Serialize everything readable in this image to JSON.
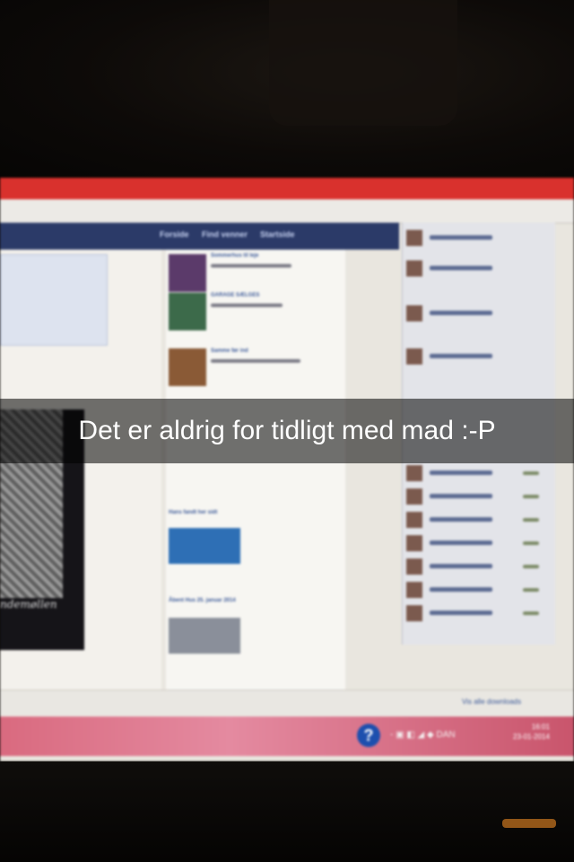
{
  "snap": {
    "caption": "Det er aldrig for tidligt med mad :-P"
  },
  "facebook": {
    "nav": [
      "Forside",
      "Find venner",
      "Startside"
    ],
    "feed": [
      {
        "title": "Sommerhus til leje"
      },
      {
        "title": "GARAGE SÆLGES"
      },
      {
        "title": "Samme før ind"
      },
      {
        "title": "Hans fandt her sidt"
      },
      {
        "title": "Åbent Hus 25. januar 2014"
      }
    ],
    "promo_text": "ndemøllen",
    "bottom_link": "Vis alle downloads"
  },
  "taskbar": {
    "help_icon_label": "?",
    "tray_text": "- ▣ ◧ ◢ ◆ DAN",
    "time": "16:01",
    "date": "23-01-2014"
  }
}
